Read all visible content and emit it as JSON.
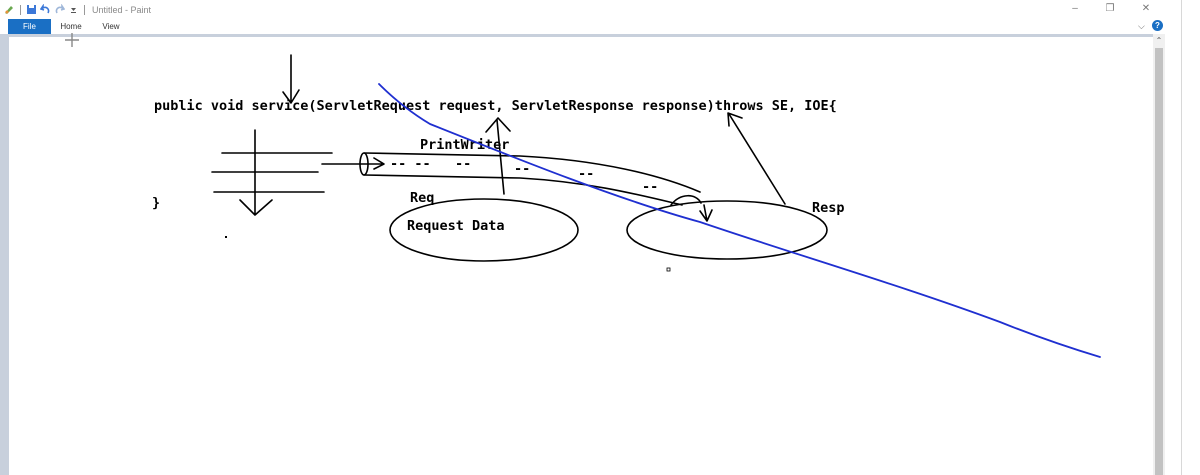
{
  "window": {
    "title": "Untitled - Paint",
    "controls": {
      "minimize": "–",
      "maximize": "❐",
      "close": "✕"
    }
  },
  "quick_access": [
    "paint-app-icon",
    "save-icon",
    "undo-icon",
    "redo-icon",
    "customize-dropdown-icon"
  ],
  "ribbon": {
    "tabs": [
      "File",
      "Home",
      "View"
    ],
    "active_tab": "File",
    "collapse_label": "⌵",
    "help_label": "?"
  },
  "canvas": {
    "code_line": "public void service(ServletRequest request, ServletResponse response)throws SE, IOE{",
    "closing_brace": "}",
    "labels": {
      "printwriter": "PrintWriter",
      "dashes": [
        "-- --",
        "--",
        "--",
        "--",
        "--"
      ],
      "req": "Req",
      "request_data": "Request Data",
      "resp": "Resp"
    }
  },
  "colors": {
    "file_tab": "#1a6fc4",
    "workspace": "#c8d0dc",
    "ink": "#000000",
    "blue_stroke": "#1f2fd0"
  }
}
